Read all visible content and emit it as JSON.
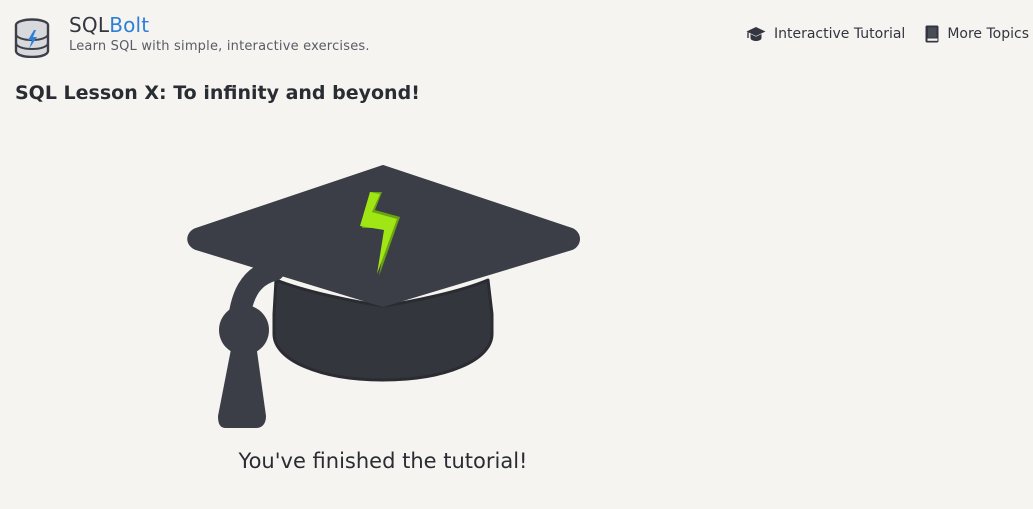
{
  "header": {
    "brand_primary": "SQL",
    "brand_accent": "Bolt",
    "tagline": "Learn SQL with simple, interactive exercises.",
    "accent_color": "#2f7fd6",
    "logo_icon": "database-bolt-icon"
  },
  "nav": {
    "items": [
      {
        "label": "Interactive Tutorial",
        "icon": "graduation-cap-icon"
      },
      {
        "label": "More Topics",
        "icon": "book-icon"
      }
    ]
  },
  "main": {
    "lesson_title": "SQL Lesson X: To infinity and beyond!",
    "illustration_icon": "graduation-cap-bolt-icon",
    "completion_message": "You've finished the tutorial!",
    "bolt_color": "#8fd61a"
  }
}
